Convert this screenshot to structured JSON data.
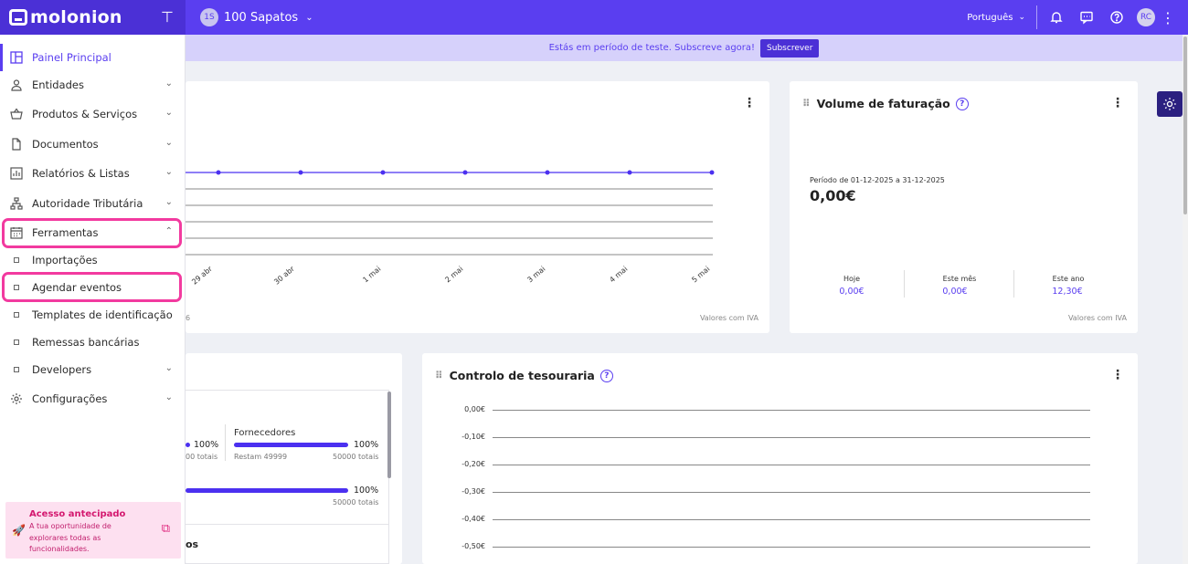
{
  "app": {
    "logo_text": "molonion",
    "company_initials": "1S",
    "company_name": "100 Sapatos",
    "language": "Português",
    "user_initials": "RC"
  },
  "trial": {
    "text": "Estás em período de teste. Subscreve agora!",
    "button": "Subscrever"
  },
  "sidebar": {
    "items": [
      {
        "label": "Painel Principal",
        "icon": "dashboard-icon"
      },
      {
        "label": "Entidades",
        "icon": "user-icon"
      },
      {
        "label": "Produtos & Serviços",
        "icon": "basket-icon"
      },
      {
        "label": "Documentos",
        "icon": "document-icon"
      },
      {
        "label": "Relatórios & Listas",
        "icon": "report-icon"
      },
      {
        "label": "Autoridade Tributária",
        "icon": "network-icon"
      },
      {
        "label": "Ferramentas",
        "icon": "calendar-icon"
      }
    ],
    "tools_sub": [
      "Importações",
      "Agendar eventos",
      "Templates de identificação",
      "Remessas bancárias"
    ],
    "developers": "Developers",
    "settings": "Configurações",
    "early_access": {
      "title": "Acesso antecipado",
      "desc": "A tua oportunidade de explorares todas as funcionalidades."
    }
  },
  "chart_card": {
    "x_labels": [
      "29 abr",
      "30 abr",
      "1 mai",
      "2 mai",
      "3 mai",
      "4 mai",
      "5 mai"
    ],
    "partial_left_text": "6",
    "footnote": "Valores com IVA"
  },
  "volume": {
    "title": "Volume de faturação",
    "period": "Período de 01-12-2025 a 31-12-2025",
    "total": "0,00€",
    "stats": [
      {
        "label": "Hoje",
        "value": "0,00€"
      },
      {
        "label": "Este mês",
        "value": "0,00€"
      },
      {
        "label": "Este ano",
        "value": "12,30€"
      }
    ],
    "footnote": "Valores com IVA"
  },
  "entities_card": {
    "pct1": "100%",
    "sub1": "00 totais",
    "suppliers_label": "Fornecedores",
    "suppliers_pct": "100%",
    "suppliers_left": "Restam 49999",
    "suppliers_total": "50000 totais",
    "pct2": "100%",
    "total2": "50000 totais",
    "partial_title": "os"
  },
  "treasury": {
    "title": "Controlo de tesouraria",
    "y_labels": [
      "0,00€",
      "-0,10€",
      "-0,20€",
      "-0,30€",
      "-0,40€",
      "-0,50€"
    ]
  }
}
